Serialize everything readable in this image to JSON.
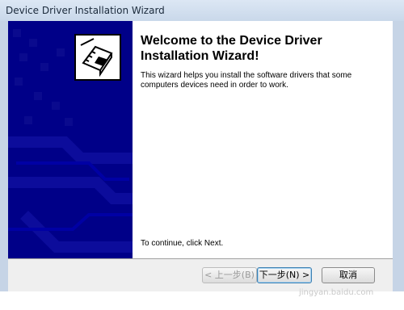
{
  "window": {
    "title": "Device Driver Installation Wizard"
  },
  "heading": {
    "line1": "Welcome to the Device Driver",
    "line2": "Installation Wizard!"
  },
  "description": {
    "line1": "This wizard helps you install the software drivers that some",
    "line2": "computers devices need in order to work."
  },
  "continue_text": "To continue, click Next.",
  "buttons": {
    "back": "< 上一步(B)",
    "next": "下一步(N) >",
    "cancel": "取消"
  },
  "watermark": "jingyan.baidu.com",
  "colors": {
    "side_panel": "#000088",
    "title_bar": "#c9d8ea"
  }
}
